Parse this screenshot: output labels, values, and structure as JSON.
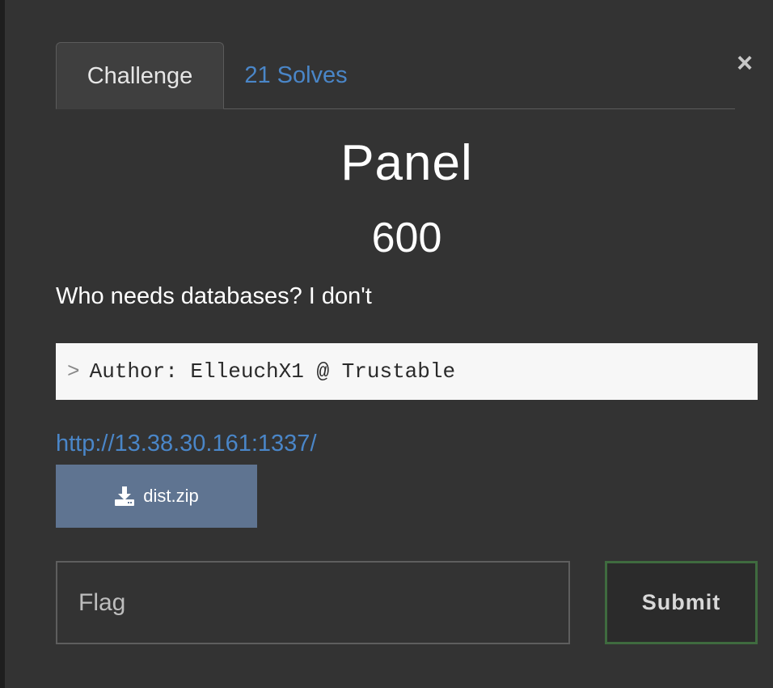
{
  "tabs": [
    {
      "label": "Challenge",
      "active": true
    },
    {
      "label": "21 Solves",
      "active": false
    }
  ],
  "close": {
    "symbol": "×",
    "icon": "close-icon"
  },
  "challenge": {
    "title": "Panel",
    "points": "600",
    "description": "Who needs databases? I don't",
    "author_prefix": ">",
    "author": "Author: ElleuchX1 @ Trustable",
    "link": "http://13.38.30.161:1337/"
  },
  "download": {
    "label": "dist.zip",
    "icon": "download-icon"
  },
  "flag": {
    "placeholder": "Flag",
    "value": ""
  },
  "submit": {
    "label": "Submit"
  },
  "colors": {
    "background": "#333333",
    "link": "#4a86c8",
    "download_button": "#5f7491",
    "submit_border": "#3f6b3f"
  }
}
